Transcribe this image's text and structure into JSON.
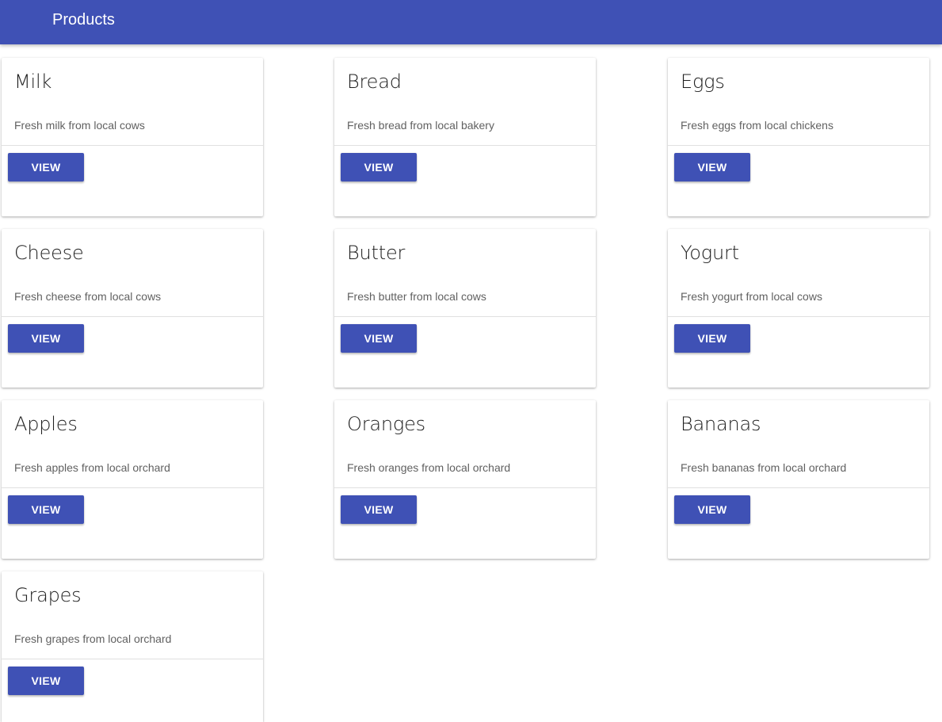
{
  "app_bar": {
    "title": "Products",
    "color": "#3f51b5"
  },
  "products": [
    {
      "name": "Milk",
      "description": "Fresh milk from local cows",
      "button_label": "VIEW"
    },
    {
      "name": "Bread",
      "description": "Fresh bread from local bakery",
      "button_label": "VIEW"
    },
    {
      "name": "Eggs",
      "description": "Fresh eggs from local chickens",
      "button_label": "VIEW"
    },
    {
      "name": "Cheese",
      "description": "Fresh cheese from local cows",
      "button_label": "VIEW"
    },
    {
      "name": "Butter",
      "description": "Fresh butter from local cows",
      "button_label": "VIEW"
    },
    {
      "name": "Yogurt",
      "description": "Fresh yogurt from local cows",
      "button_label": "VIEW"
    },
    {
      "name": "Apples",
      "description": "Fresh apples from local orchard",
      "button_label": "VIEW"
    },
    {
      "name": "Oranges",
      "description": "Fresh oranges from local orchard",
      "button_label": "VIEW"
    },
    {
      "name": "Bananas",
      "description": "Fresh bananas from local orchard",
      "button_label": "VIEW"
    },
    {
      "name": "Grapes",
      "description": "Fresh grapes from local orchard",
      "button_label": "VIEW"
    }
  ]
}
